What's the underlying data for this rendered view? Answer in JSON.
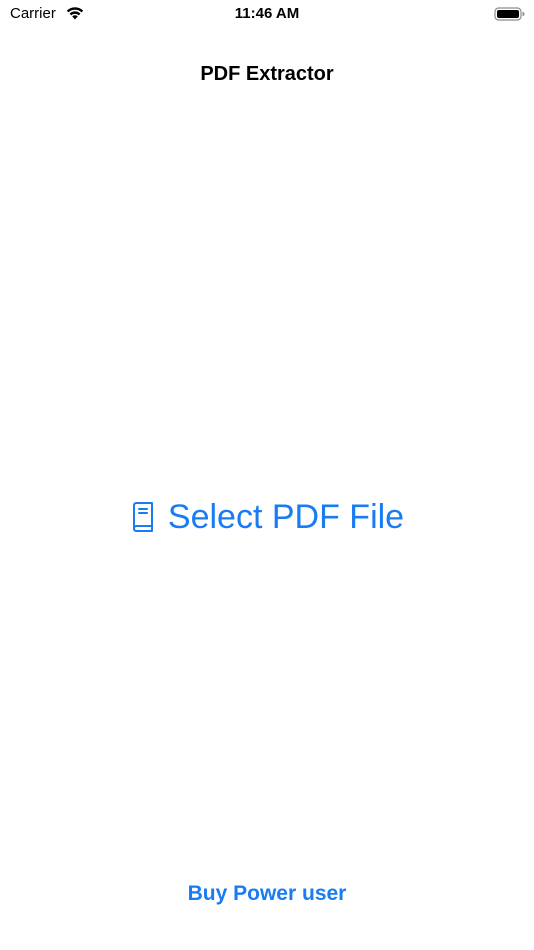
{
  "status_bar": {
    "carrier": "Carrier",
    "time": "11:46 AM",
    "wifi_icon": "wifi-icon",
    "battery_icon": "battery-icon"
  },
  "nav": {
    "title": "PDF Extractor"
  },
  "main": {
    "select_button": {
      "icon": "book-icon",
      "label": "Select PDF File"
    }
  },
  "footer": {
    "buy_label": "Buy Power user"
  },
  "colors": {
    "accent": "#1a7cf2",
    "text": "#000000",
    "background": "#ffffff"
  }
}
